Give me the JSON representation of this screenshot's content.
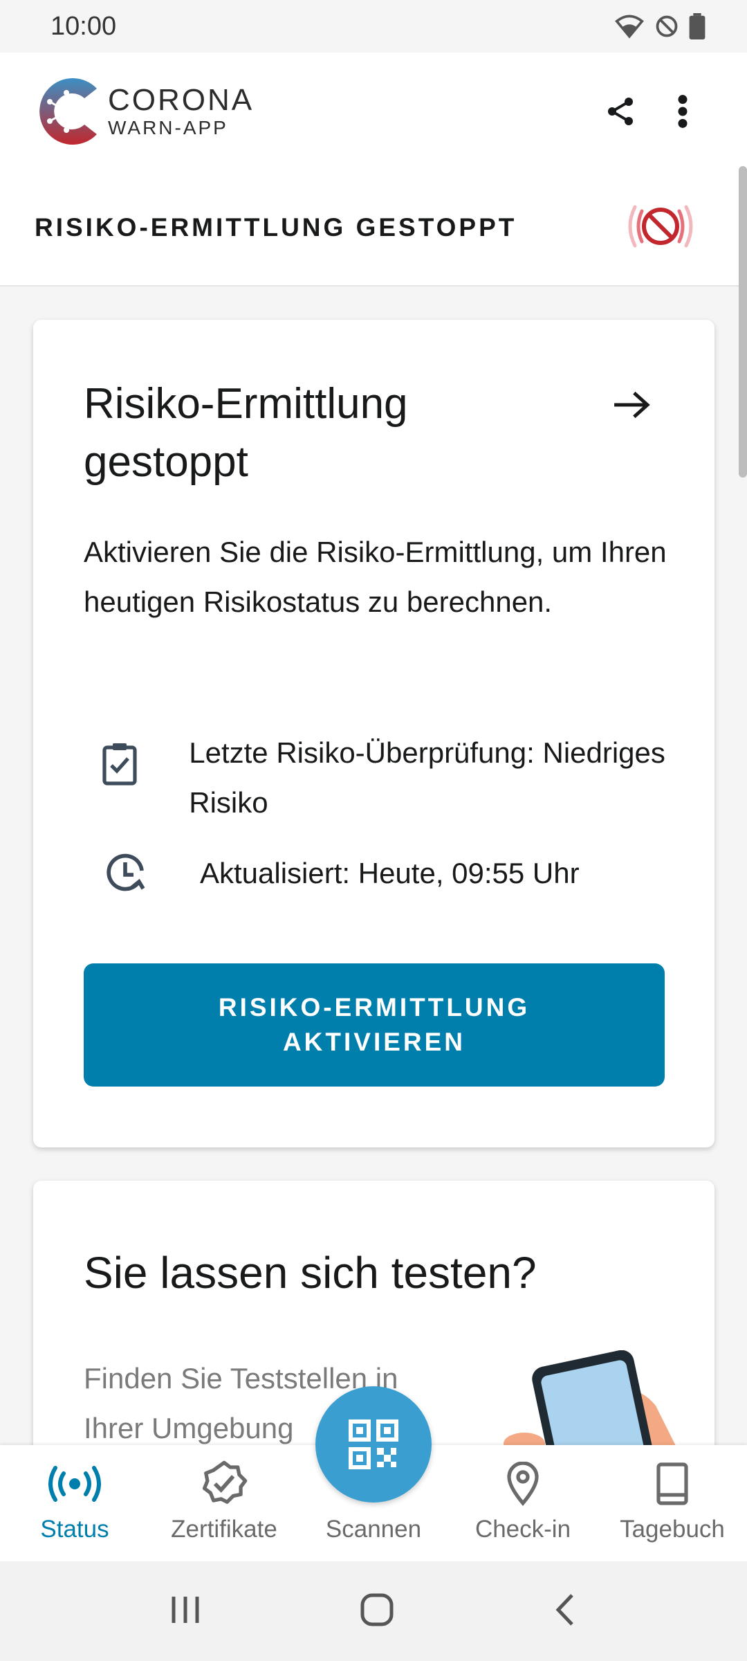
{
  "status_bar": {
    "time": "10:00"
  },
  "app_bar": {
    "logo_title": "CORONA",
    "logo_subtitle": "WARN-APP"
  },
  "risk_header": {
    "title": "RISIKO-ERMITTLUNG GESTOPPT"
  },
  "risk_card": {
    "title": "Risiko-Ermittlung gestoppt",
    "text": "Aktivieren Sie die Risiko-Ermittlung, um Ihren heutigen Risikostatus zu berechnen.",
    "last_check": "Letzte Risiko-Überprüfung: Niedriges Risiko",
    "updated": "Aktualisiert: Heute, 09:55 Uhr",
    "button": "RISIKO-ERMITTLUNG AKTIVIEREN"
  },
  "test_card": {
    "title": "Sie lassen sich testen?",
    "text": "Finden Sie Teststellen in Ihrer Umgebung"
  },
  "bottom_nav": {
    "items": [
      {
        "label": "Status",
        "icon": "broadcast-icon",
        "active": true
      },
      {
        "label": "Zertifikate",
        "icon": "certificate-badge-icon"
      },
      {
        "label": "Scannen",
        "icon": "qr-code-icon"
      },
      {
        "label": "Check-in",
        "icon": "location-pin-icon"
      },
      {
        "label": "Tagebuch",
        "icon": "book-icon"
      }
    ]
  },
  "colors": {
    "accent": "#007fad",
    "fab": "#3a9fd0",
    "alert_red": "#c1272d"
  }
}
